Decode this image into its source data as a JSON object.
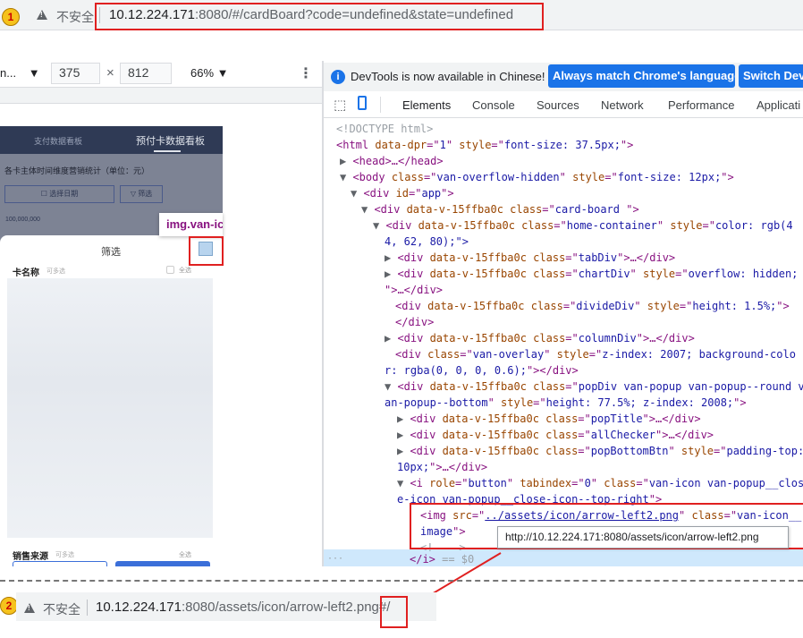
{
  "top_bar": {
    "badge": "1",
    "security": "不安全",
    "url_host": "10.12.224.171",
    "url_rest": ":8080/#/cardBoard?code=undefined&state=undefined"
  },
  "device_toolbar": {
    "device": "n...",
    "width": "375",
    "times": "×",
    "height": "812",
    "zoom": "66%"
  },
  "phone": {
    "tab1": "支付数据看板",
    "tab2": "预付卡数据看板",
    "chart_title": "各卡主体时间维度营销统计（单位：元）",
    "btn_date": "☐ 选择日期",
    "btn_filter": "▽ 筛选",
    "y_value": "100,000,000",
    "inspect_label": "img.van-ic",
    "pop_title": "筛选",
    "card_name": "卡名称",
    "multi": "可多选",
    "select_all": "全选",
    "sales_source": "销售来源",
    "multi2": "可多选",
    "select_all2": "全选"
  },
  "devtools": {
    "banner": "DevTools is now available in Chinese!",
    "btn_match": "Always match Chrome's language",
    "btn_switch": "Switch Dev",
    "tabs": [
      "Elements",
      "Console",
      "Sources",
      "Network",
      "Performance",
      "Applicati"
    ]
  },
  "dom": {
    "l1": "<!DOCTYPE html>",
    "l2a": "<html ",
    "l2b": "data-dpr",
    "l2c": "=\"",
    "l2d": "1",
    "l2e": "\" ",
    "l2f": "style",
    "l2g": "=\"",
    "l2h": "font-size: 37.5px;",
    "l2i": "\">",
    "l3": "<head>…</head>",
    "l4a": "<body ",
    "l4b": "class",
    "l4c": "van-overflow-hidden",
    "l4d": "style",
    "l4e": "font-size: 12px;",
    "l5a": "<div ",
    "l5b": "id",
    "l5c": "app",
    "l6a": "<div ",
    "l6b": "data-v-15ffba0c class",
    "l6c": "card-board ",
    "l7a": "<div ",
    "l7b": "data-v-15ffba0c class",
    "l7c": "home-container",
    "l7d": "style",
    "l7e": "color: rgb(4",
    "l8": "4, 62, 80);\">",
    "l9a": "<div ",
    "l9b": "data-v-15ffba0c class",
    "l9c": "tabDiv",
    "l9d": ">…</div>",
    "l10a": "<div ",
    "l10b": "data-v-15ffba0c class",
    "l10c": "chartDiv",
    "l10d": "style",
    "l10e": "overflow: hidden;",
    "l11": "\">…</div>",
    "l12a": "<div ",
    "l12b": "data-v-15ffba0c class",
    "l12c": "divideDiv",
    "l12d": "style",
    "l12e": "height: 1.5%;",
    "l13": "</div>",
    "l14a": "<div ",
    "l14b": "data-v-15ffba0c class",
    "l14c": "columnDiv",
    "l14d": ">…</div>",
    "l15a": "<div ",
    "l15b": "class",
    "l15c": "van-overlay",
    "l15d": "style",
    "l15e": "z-index: 2007; background-colo",
    "l16a": "r: rgba(0, 0, 0, 0.6);",
    "l16b": "\"></div>",
    "l17a": "<div ",
    "l17b": "data-v-15ffba0c class",
    "l17c": "popDiv van-popup van-popup--round v",
    "l18a": "an-popup--bottom",
    "l18b": "style",
    "l18c": "height: 77.5%; z-index: 2008;",
    "l19a": "<div ",
    "l19b": "data-v-15ffba0c class",
    "l19c": "popTitle",
    "l19d": ">…</div>",
    "l20a": "<div ",
    "l20b": "data-v-15ffba0c class",
    "l20c": "allChecker",
    "l20d": ">…</div>",
    "l21a": "<div ",
    "l21b": "data-v-15ffba0c class",
    "l21c": "popBottomBtn",
    "l21d": "style",
    "l21e": "padding-top:",
    "l22a": "10px;",
    "l22b": "\">…</div>",
    "l23a": "<i ",
    "l23b": "role",
    "l23c": "button",
    "l23d": "tabindex",
    "l23e": "0",
    "l23f": "class",
    "l23g": "van-icon van-popup__clos",
    "l24": "e-icon van-popup__close-icon--top-right",
    "l25a": "<img ",
    "l25b": "src",
    "l25c": "../assets/icon/arrow-left2.png",
    "l25d": "class",
    "l25e": "van-icon__",
    "l26": "image",
    "l27": "<!---->",
    "l28a": "</i>",
    "l28b": " == $0"
  },
  "tooltip": "http://10.12.224.171:8080/assets/icon/arrow-left2.png",
  "bottom_bar": {
    "badge": "2",
    "security": "不安全",
    "url_host": "10.12.224.171",
    "url_rest": ":8080/assets/icon/arrow-left2.png",
    "url_hash": "#/"
  }
}
